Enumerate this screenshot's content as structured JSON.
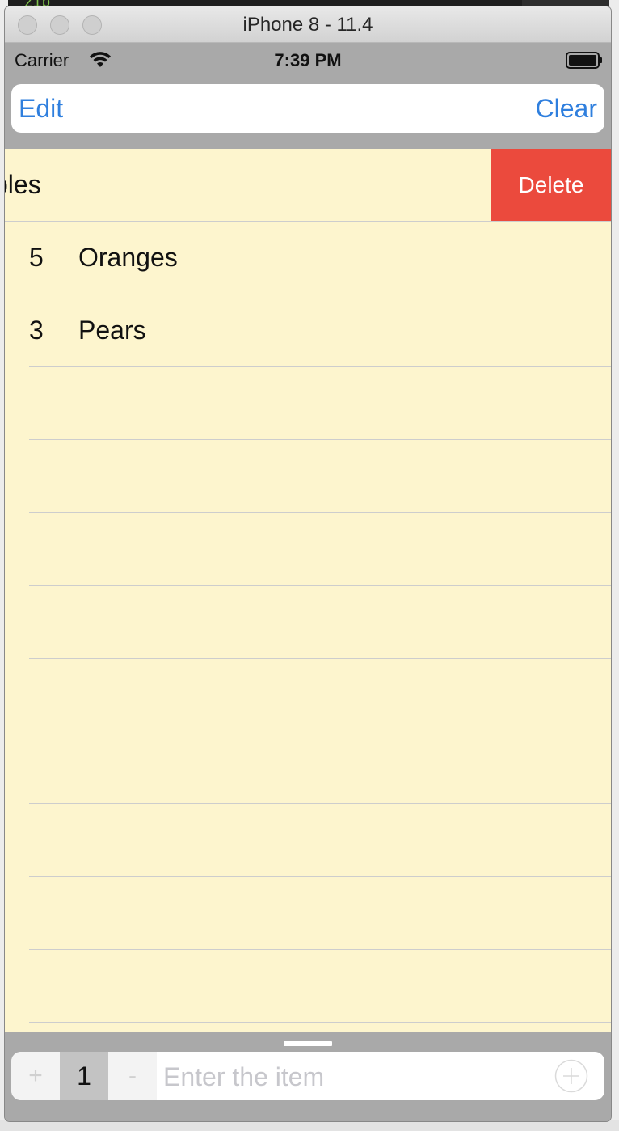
{
  "simulator": {
    "title": "iPhone 8 - 11.4"
  },
  "status_bar": {
    "carrier": "Carrier",
    "time": "7:39 PM"
  },
  "nav": {
    "edit_label": "Edit",
    "clear_label": "Clear"
  },
  "rows": [
    {
      "qty": "",
      "name": "ples",
      "swiped": true,
      "action_label": "Delete"
    },
    {
      "qty": "5",
      "name": "Oranges"
    },
    {
      "qty": "3",
      "name": "Pears"
    }
  ],
  "input_bar": {
    "plus_label": "+",
    "quantity": "1",
    "minus_label": "-",
    "placeholder": "Enter the item"
  },
  "colors": {
    "accent": "#2f7fde",
    "delete": "#eb4a3d",
    "table_bg": "#fdf5ce"
  },
  "icons": [
    "wifi-icon",
    "battery-icon",
    "add-circle-icon"
  ]
}
